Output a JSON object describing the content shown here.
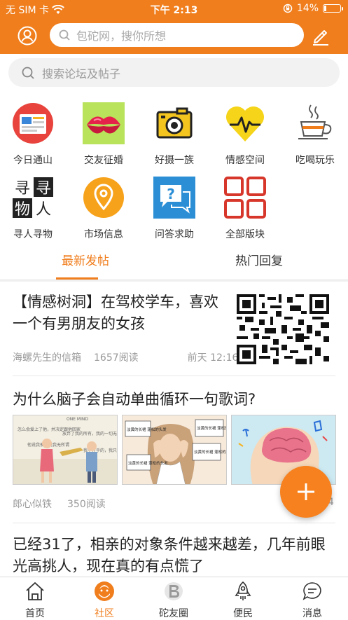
{
  "status_bar": {
    "carrier": "无 SIM 卡",
    "time": "下午 2:13",
    "battery_percent": "14%",
    "battery_level": 0.14
  },
  "header": {
    "search_placeholder": "包砣网，搜你所想"
  },
  "forum_search": {
    "placeholder": "搜索论坛及帖子"
  },
  "categories": [
    {
      "label": "今日通山",
      "icon": "news-board-icon"
    },
    {
      "label": "交友征婚",
      "icon": "lips-icon"
    },
    {
      "label": "好摄一族",
      "icon": "camera-icon"
    },
    {
      "label": "情感空间",
      "icon": "heartbeat-icon"
    },
    {
      "label": "吃喝玩乐",
      "icon": "teacup-icon"
    },
    {
      "label": "寻人寻物",
      "icon": "search-people-icon"
    },
    {
      "label": "市场信息",
      "icon": "location-pin-icon"
    },
    {
      "label": "问答求助",
      "icon": "question-bubble-icon"
    },
    {
      "label": "全部版块",
      "icon": "all-sections-icon"
    }
  ],
  "tabs": [
    {
      "label": "最新发帖",
      "active": true
    },
    {
      "label": "热门回复",
      "active": false
    }
  ],
  "posts": [
    {
      "title": "【情感树洞】在驾校学车，喜欢一个有男朋友的女孩",
      "author": "海螺先生的信箱",
      "reads": "1657阅读",
      "time": "前天 12:16"
    },
    {
      "title": "为什么脑子会自动单曲循环一句歌词?",
      "author": "郎心似铁",
      "reads": "350阅读",
      "time_partial": "4"
    },
    {
      "title": "已经31了，相亲的对象条件越来越差，几年前眼光高挑人，现在真的有点慌了"
    }
  ],
  "thumbnails": {
    "t1_text_a": "怎么会爱上了他，并决定跟他回家",
    "t1_text_b": "放弃了我的所有，我的一切无所谓",
    "t1_text_c": "他说我傻，说我无所谓",
    "t1_text_d": "我不在乎的，我只在乎你",
    "t1_text_e": "ONE MIND",
    "t2_bubble": "淡黄的长裙 蓬松的头发"
  },
  "bottom_nav": [
    {
      "label": "首页",
      "icon": "home-icon",
      "active": false
    },
    {
      "label": "社区",
      "icon": "community-icon",
      "active": true
    },
    {
      "label": "砣友圈",
      "icon": "friends-circle-icon",
      "active": false
    },
    {
      "label": "便民",
      "icon": "rocket-icon",
      "active": false
    },
    {
      "label": "消息",
      "icon": "message-icon",
      "active": false
    }
  ],
  "colors": {
    "brand_orange": "#f07e1d",
    "text_primary": "#222222",
    "text_secondary": "#999999"
  }
}
